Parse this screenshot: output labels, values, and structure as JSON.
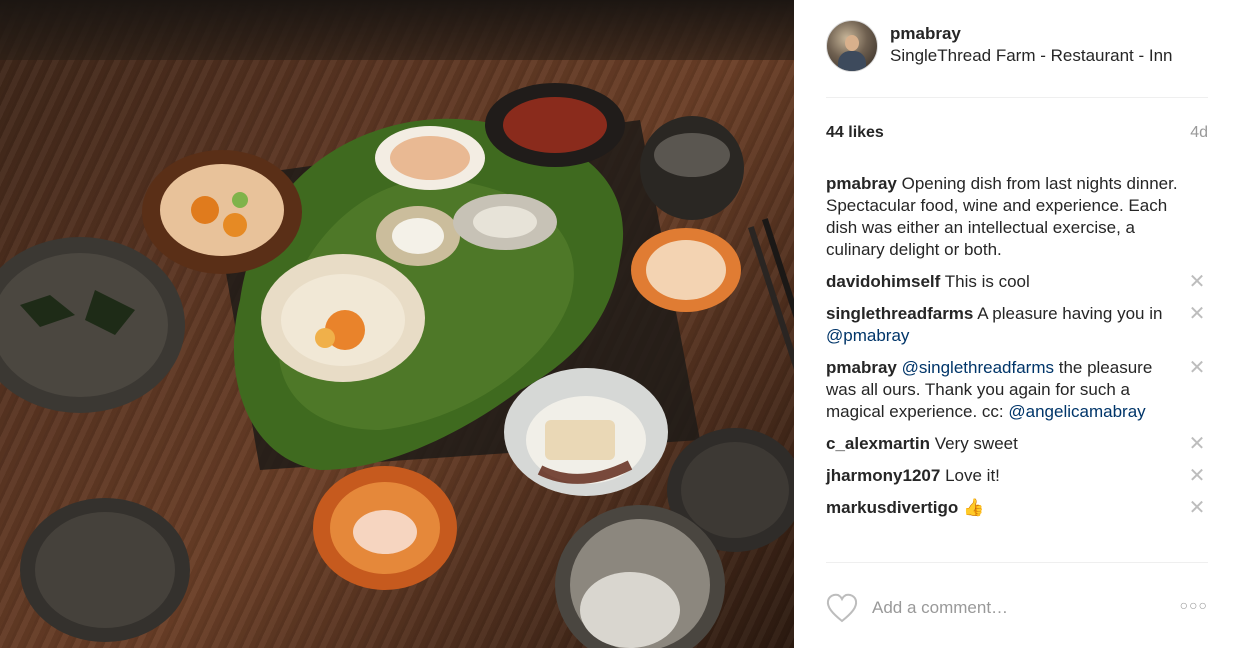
{
  "post": {
    "photo_alt": "Table of small dishes on moss",
    "username": "pmabray",
    "location": "SingleThread Farm - Restaurant - Inn",
    "likes": "44 likes",
    "time": "4d",
    "caption": {
      "user": "pmabray",
      "text": "Opening dish from last nights dinner. Spectacular food, wine and experience. Each dish was either an intellectual exercise, a culinary delight or both."
    }
  },
  "comments": [
    {
      "user": "davidohimself",
      "text": "This is cool"
    },
    {
      "user": "singlethreadfarms",
      "text": "A pleasure having you in ",
      "mention": "@pmabray"
    },
    {
      "user": "pmabray",
      "mention": "@singlethreadfarms",
      "text": " the pleasure was all ours. Thank you again for such a magical experience. cc: ",
      "mention2": "@angelicamabray"
    },
    {
      "user": "c_alexmartin",
      "text": "Very sweet"
    },
    {
      "user": "jharmony1207",
      "text": "Love it!"
    },
    {
      "user": "markusdivertigo",
      "text": "👍"
    }
  ],
  "ui": {
    "delete_glyph": "✕",
    "add_comment_placeholder": "Add a comment…",
    "more_glyph": "○○○",
    "link_color": "#003569",
    "text_color": "#262626",
    "muted_color": "#999999"
  }
}
